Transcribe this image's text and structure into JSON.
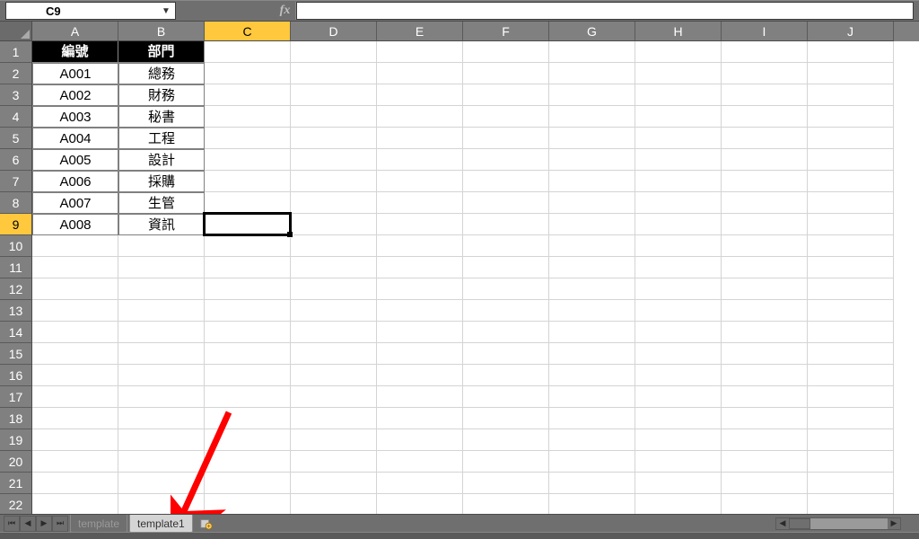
{
  "namebox": {
    "value": "C9"
  },
  "fx": {
    "label": "fx",
    "value": ""
  },
  "columns": [
    "A",
    "B",
    "C",
    "D",
    "E",
    "F",
    "G",
    "H",
    "I",
    "J"
  ],
  "active_column": "C",
  "active_row": 9,
  "num_rows": 22,
  "selected_cell": {
    "row": 9,
    "col": "C"
  },
  "table": {
    "headers": {
      "a": "編號",
      "b": "部門"
    },
    "rows": [
      {
        "a": "A001",
        "b": "總務"
      },
      {
        "a": "A002",
        "b": "財務"
      },
      {
        "a": "A003",
        "b": "秘書"
      },
      {
        "a": "A004",
        "b": "工程"
      },
      {
        "a": "A005",
        "b": "設計"
      },
      {
        "a": "A006",
        "b": "採購"
      },
      {
        "a": "A007",
        "b": "生管"
      },
      {
        "a": "A008",
        "b": "資訊"
      }
    ]
  },
  "sheets": {
    "tabs": [
      "template",
      "template1"
    ],
    "active": "template1"
  },
  "annotation": {
    "arrow_color": "#ff0000"
  },
  "chart_data": {
    "type": "table",
    "title": "",
    "headers": [
      "編號",
      "部門"
    ],
    "rows": [
      [
        "A001",
        "總務"
      ],
      [
        "A002",
        "財務"
      ],
      [
        "A003",
        "秘書"
      ],
      [
        "A004",
        "工程"
      ],
      [
        "A005",
        "設計"
      ],
      [
        "A006",
        "採購"
      ],
      [
        "A007",
        "生管"
      ],
      [
        "A008",
        "資訊"
      ]
    ]
  }
}
